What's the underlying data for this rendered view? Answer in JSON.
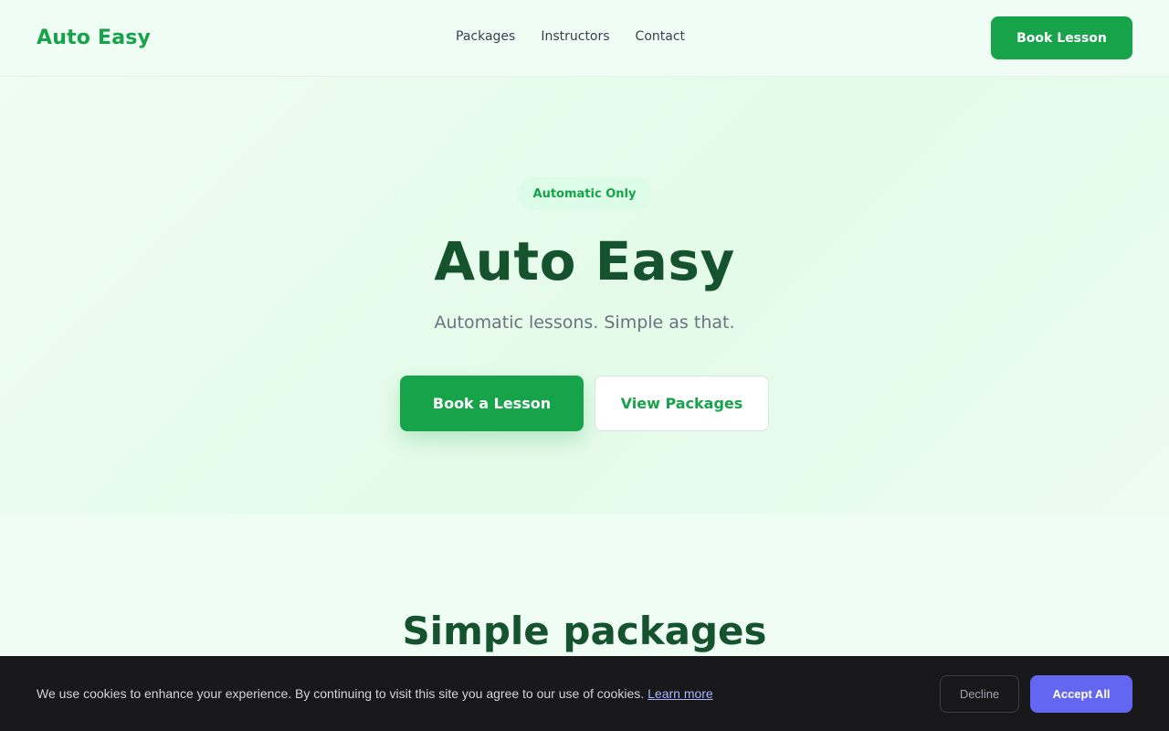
{
  "header": {
    "brand": "Auto Easy",
    "nav": [
      "Packages",
      "Instructors",
      "Contact"
    ],
    "cta_label": "Book Lesson"
  },
  "hero": {
    "badge": "Automatic Only",
    "title": "Auto Easy",
    "subtitle": "Automatic lessons. Simple as that.",
    "primary_cta": "Book a Lesson",
    "secondary_cta": "View Packages"
  },
  "packages": {
    "title": "Simple packages"
  },
  "cookie_banner": {
    "message": "We use cookies to enhance your experience. By continuing to visit this site you agree to our use of cookies.",
    "link_label": "Learn more",
    "decline_label": "Decline",
    "accept_label": "Accept All"
  },
  "colors": {
    "brand_green": "#16a34a",
    "dark_green": "#14532d",
    "accent_indigo": "#6366f1",
    "banner_bg": "#18181b"
  }
}
